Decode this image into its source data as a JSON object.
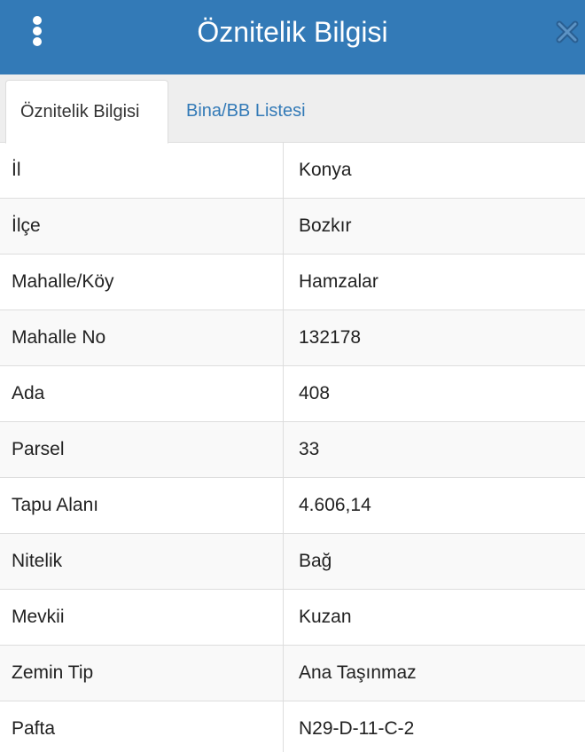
{
  "header": {
    "title": "Öznitelik Bilgisi",
    "menu_icon": "vertical-dots-icon",
    "close_icon": "close-icon",
    "bg_color": "#337ab7"
  },
  "tabs": [
    {
      "label": "Öznitelik Bilgisi",
      "active": true
    },
    {
      "label": "Bina/BB Listesi",
      "active": false
    }
  ],
  "attributes": [
    {
      "key": "İl",
      "value": "Konya"
    },
    {
      "key": "İlçe",
      "value": "Bozkır"
    },
    {
      "key": "Mahalle/Köy",
      "value": "Hamzalar"
    },
    {
      "key": "Mahalle No",
      "value": "132178"
    },
    {
      "key": "Ada",
      "value": "408"
    },
    {
      "key": "Parsel",
      "value": "33"
    },
    {
      "key": "Tapu Alanı",
      "value": "4.606,14"
    },
    {
      "key": "Nitelik",
      "value": "Bağ"
    },
    {
      "key": "Mevkii",
      "value": "Kuzan"
    },
    {
      "key": "Zemin Tip",
      "value": "Ana Taşınmaz"
    },
    {
      "key": "Pafta",
      "value": "N29-D-11-C-2"
    }
  ]
}
